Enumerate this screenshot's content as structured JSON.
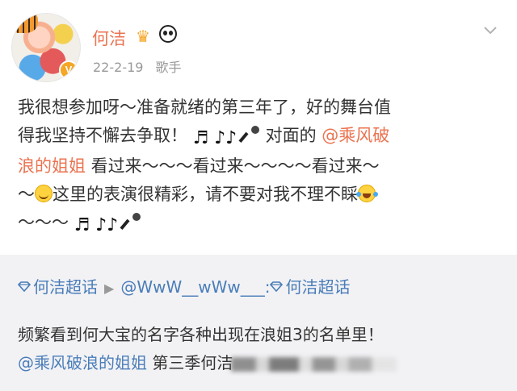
{
  "post": {
    "author_name": "何洁",
    "badge_crown": "♛",
    "verified_mark": "V",
    "date": "22-2-19",
    "source": "歌手",
    "lines": [
      {
        "t1": "我很想参加呀～准备就绪的第三年了，好的舞台值"
      },
      {
        "t1": "得我坚持不懈去争取！",
        "mid": "对面的",
        "mention": "@乘风破"
      },
      {
        "mention": "浪的姐姐",
        "t1": " 看过来～～～看过来～～～～看过来～"
      },
      {
        "t0": "～",
        "t1": "这里的表演很精彩，请不要对我不理不睬"
      },
      {
        "t1": "～～～"
      }
    ],
    "note_glyphs": "♬ ♪♪"
  },
  "repost": {
    "topic_label": "何洁超话",
    "sep": "▶",
    "user": "@WwW__wWw___:",
    "user_topic": "何洁超话",
    "line1": "频繁看到何大宝的名字各种出现在浪姐3的名单里！",
    "mention": "@乘风破浪的姐姐",
    "line2": " 第三季何洁"
  }
}
